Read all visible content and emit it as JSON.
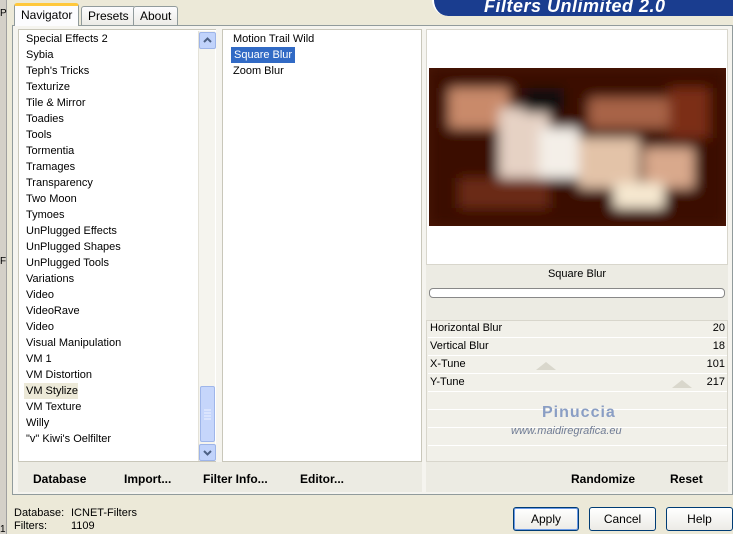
{
  "left_strip_chars": [
    "P",
    "F",
    "1"
  ],
  "tabs": [
    {
      "label": "Navigator",
      "active": true
    },
    {
      "label": "Presets",
      "active": false
    },
    {
      "label": "About",
      "active": false
    }
  ],
  "banner_title": "Filters Unlimited 2.0",
  "categories": [
    "Special Effects 2",
    "Sybia",
    "Teph's Tricks",
    "Texturize",
    "Tile & Mirror",
    "Toadies",
    "Tools",
    "Tormentia",
    "Tramages",
    "Transparency",
    "Two Moon",
    "Tymoes",
    "UnPlugged Effects",
    "UnPlugged Shapes",
    "UnPlugged Tools",
    "Variations",
    "Video",
    "VideoRave",
    "Video",
    "Visual Manipulation",
    "VM 1",
    "VM Distortion",
    "VM Stylize",
    "VM Texture",
    "Willy",
    "\"v\" Kiwi's Oelfilter"
  ],
  "selected_category": "VM Stylize",
  "filters": [
    "Motion Trail Wild",
    "Square Blur",
    "Zoom Blur"
  ],
  "selected_filter": "Square Blur",
  "left_buttons": {
    "database": "Database",
    "import": "Import...",
    "filter_info": "Filter Info...",
    "editor": "Editor..."
  },
  "filter_name": "Square Blur",
  "params": [
    {
      "label": "Horizontal Blur",
      "value": "20"
    },
    {
      "label": "Vertical Blur",
      "value": "18"
    },
    {
      "label": "X-Tune",
      "value": "101"
    },
    {
      "label": "Y-Tune",
      "value": "217"
    }
  ],
  "watermark": {
    "name": "Pinuccia",
    "url": "www.maidiregrafica.eu"
  },
  "right_buttons": {
    "randomize": "Randomize",
    "reset": "Reset"
  },
  "status": {
    "database_label": "Database:",
    "database_value": "ICNET-Filters",
    "filters_label": "Filters:",
    "filters_value": "1109"
  },
  "dialog_buttons": {
    "apply": "Apply",
    "cancel": "Cancel",
    "help": "Help"
  },
  "colors": {
    "banner": "#1a3d8f",
    "selection": "#316ac5",
    "tab_accent": "#ffc83c"
  }
}
